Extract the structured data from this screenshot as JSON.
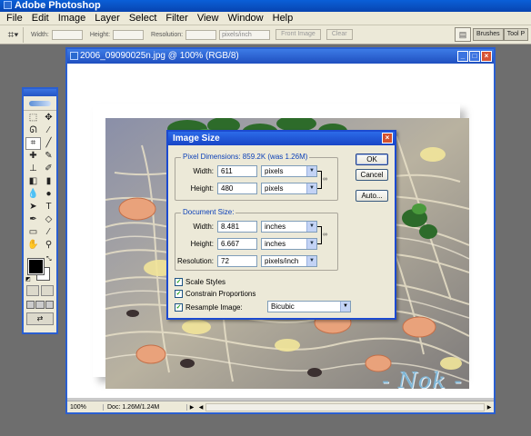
{
  "app": {
    "title": "Adobe Photoshop"
  },
  "menu": [
    "File",
    "Edit",
    "Image",
    "Layer",
    "Select",
    "Filter",
    "View",
    "Window",
    "Help"
  ],
  "options_bar": {
    "width_label": "Width:",
    "height_label": "Height:",
    "resolution_label": "Resolution:",
    "resolution_unit": "pixels/inch",
    "front_image_button": "Front Image",
    "clear_button": "Clear",
    "brushes_tab": "Brushes",
    "tool_presets_tab": "Tool P"
  },
  "document": {
    "title": "2006_09090025n.jpg @ 100% (RGB/8)",
    "zoom": "100%",
    "doc_info": "Doc: 1.26M/1.24M",
    "signature": "- Nok -"
  },
  "dialog": {
    "title": "Image Size",
    "pixel_dimensions_label": "Pixel Dimensions:  859.2K (was 1.26M)",
    "px_width_label": "Width:",
    "px_width_value": "611",
    "px_width_unit": "pixels",
    "px_height_label": "Height:",
    "px_height_value": "480",
    "px_height_unit": "pixels",
    "document_size_label": "Document Size:",
    "doc_width_label": "Width:",
    "doc_width_value": "8.481",
    "doc_width_unit": "inches",
    "doc_height_label": "Height:",
    "doc_height_value": "6.667",
    "doc_height_unit": "inches",
    "resolution_label": "Resolution:",
    "resolution_value": "72",
    "resolution_unit": "pixels/inch",
    "scale_styles": "Scale Styles",
    "constrain_proportions": "Constrain Proportions",
    "resample_image": "Resample Image:",
    "resample_method": "Bicubic",
    "ok_button": "OK",
    "cancel_button": "Cancel",
    "auto_button": "Auto..."
  },
  "colors": {
    "title_bar": "#0a5fd8",
    "dialog_chrome": "#ece9d8",
    "group_label": "#0a3fb8"
  }
}
